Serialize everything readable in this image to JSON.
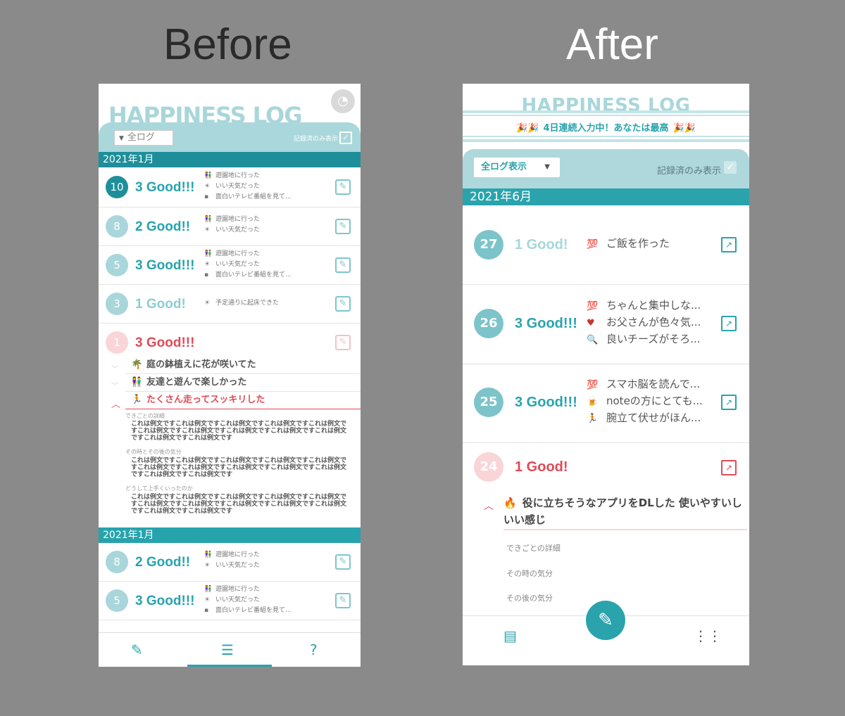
{
  "headings": {
    "before": "Before",
    "after": "After"
  },
  "before": {
    "title": "HAPPINESS LOG",
    "filter": "全ログ",
    "recorded_only": "記録済のみ表示",
    "month1": "2021年1月",
    "month2": "2021年1月",
    "entries": [
      {
        "day": "10",
        "good": "3 Good!!!",
        "items": [
          "遊園地に行った",
          "いい天気だった",
          "面白いテレビ番組を見て..."
        ]
      },
      {
        "day": "8",
        "good": "2 Good!!",
        "items": [
          "遊園地に行った",
          "いい天気だった"
        ]
      },
      {
        "day": "5",
        "good": "3 Good!!!",
        "items": [
          "遊園地に行った",
          "いい天気だった",
          "面白いテレビ番組を見て..."
        ]
      },
      {
        "day": "3",
        "good": "1 Good!",
        "items": [
          "予定通りに起床できた"
        ]
      }
    ],
    "expanded": {
      "day": "1",
      "good": "3 Good!!!",
      "subs": [
        "庭の鉢植えに花が咲いてた",
        "友達と遊んで楽しかった",
        "たくさん走ってスッキリした"
      ],
      "label1": "できごとの詳細",
      "label2": "その時とその後の気分",
      "label3": "どうして上手くいったのか",
      "para": "これは例文ですこれは例文ですこれは例文ですこれは例文ですこれは例文ですこれは例文ですこれは例文ですこれは例文ですこれは例文ですこれは例文ですこれは例文ですこれは例文です"
    },
    "entries2": [
      {
        "day": "8",
        "good": "2 Good!!",
        "items": [
          "遊園地に行った",
          "いい天気だった"
        ]
      },
      {
        "day": "5",
        "good": "3 Good!!!",
        "items": [
          "遊園地に行った",
          "いい天気だった",
          "面白いテレビ番組を見て..."
        ]
      }
    ]
  },
  "after": {
    "title": "HAPPINESS LOG",
    "streak": "4日連続入力中！あなたは最高",
    "filter": "全ログ表示",
    "recorded_only": "記録済のみ表示",
    "month": "2021年6月",
    "entries": [
      {
        "day": "27",
        "good": "1 Good!",
        "items": [
          "ご飯を作った"
        ]
      },
      {
        "day": "26",
        "good": "3 Good!!!",
        "items": [
          "ちゃんと集中しな...",
          "お父さんが色々気...",
          "良いチーズがそろ..."
        ]
      },
      {
        "day": "25",
        "good": "3 Good!!!",
        "items": [
          "スマホ脳を読んで...",
          "noteの方にとても...",
          "腕立て伏せがほん..."
        ]
      }
    ],
    "expanded": {
      "day": "24",
      "good": "1 Good!",
      "detail": "役に立ちそうなアプリをDLした 使いやすいしいい感じ",
      "label1": "できごとの詳細",
      "label2": "その時の気分",
      "label3": "その後の気分"
    }
  },
  "colors": {
    "teal": "#2aa3ad",
    "light_teal": "#aad7db",
    "pink": "#e04b57",
    "pink_light": "#f9d5d8"
  }
}
